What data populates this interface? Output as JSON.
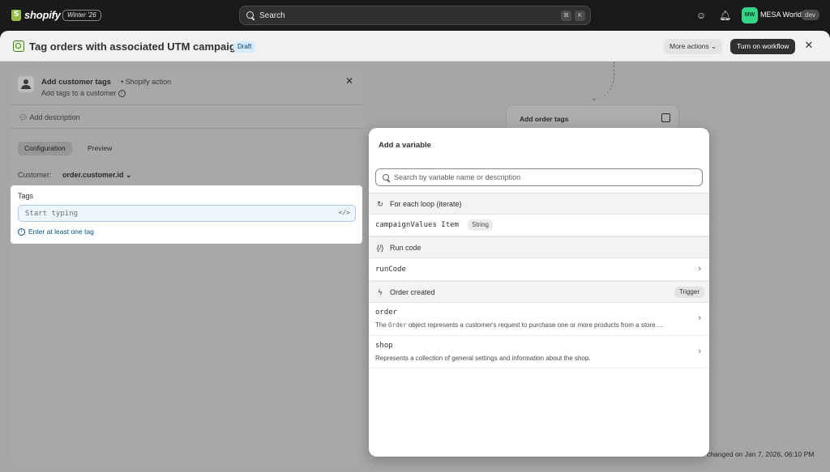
{
  "topbar": {
    "logo_text": "shopify",
    "edition": "Winter '26",
    "search_placeholder": "Search",
    "shortcut_keys": [
      "⌘",
      "K"
    ],
    "avatar_initials": "MW",
    "store_name": "MESA World",
    "store_tag": "dev"
  },
  "header": {
    "title": "Tag orders with associated UTM campaign",
    "status_badge": "Draft",
    "more_actions": "More actions",
    "turn_on": "Turn on workflow"
  },
  "canvas": {
    "order_tags_card": "Add order tags",
    "footer": "changed on Jan 7, 2026, 06:10 PM"
  },
  "panel": {
    "title": "Add customer tags",
    "action_type": "• Shopify action",
    "subtitle": "Add tags to a customer",
    "add_description": "Add description",
    "tabs": [
      "Configuration",
      "Preview"
    ],
    "customer_label": "Customer:",
    "customer_value": "order.customer.id",
    "tags_label": "Tags",
    "tags_placeholder": "Start typing",
    "tags_error": "Enter at least one tag"
  },
  "modal": {
    "title": "Add a variable",
    "search_placeholder": "Search by variable name or description",
    "sections": [
      {
        "label": "For each loop (iterate)",
        "icon": "loop-icon"
      },
      {
        "label": "Run code",
        "icon": "code-icon"
      },
      {
        "label": "Order created",
        "icon": "bolt-icon",
        "badge": "Trigger"
      }
    ],
    "rows": [
      {
        "name": "campaignValues Item",
        "type": "String"
      },
      {
        "name": "runCode"
      },
      {
        "name": "order",
        "desc_pre": "The ",
        "desc_code": "Order",
        "desc_post": " object represents a customer's request to purchase one or more products from a store...."
      },
      {
        "name": "shop",
        "desc": "Represents a collection of general settings and information about the shop."
      }
    ]
  }
}
